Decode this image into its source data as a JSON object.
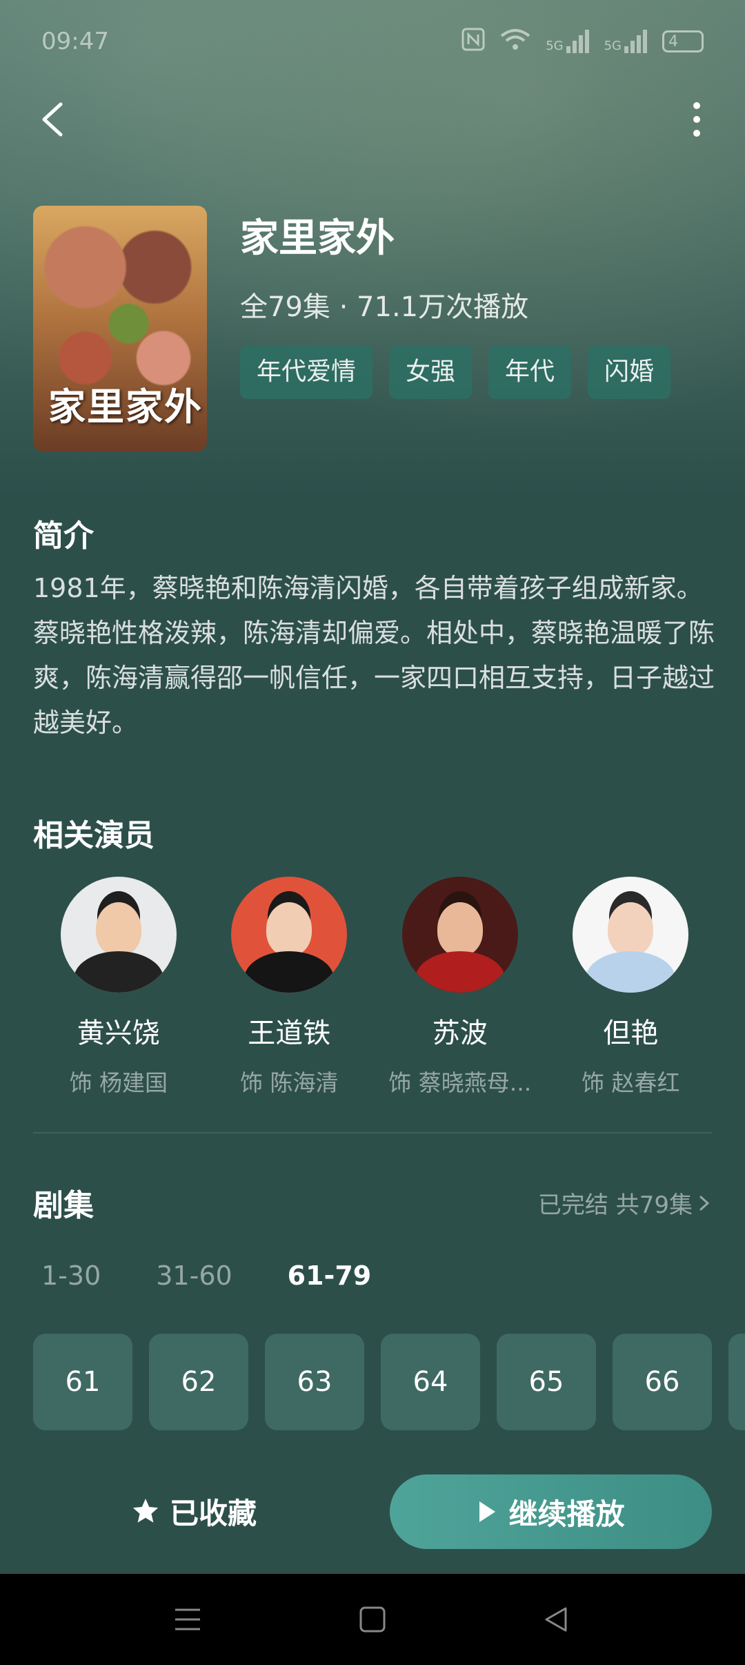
{
  "status_bar": {
    "time": "09:47",
    "network_1": "5G",
    "network_2": "5G",
    "battery": "4"
  },
  "drama": {
    "title": "家里家外",
    "meta": "全79集 · 71.1万次播放",
    "poster_title": "家里家外",
    "tags": [
      "年代爱情",
      "女强",
      "年代",
      "闪婚"
    ]
  },
  "synopsis": {
    "heading": "简介",
    "text": "1981年，蔡晓艳和陈海清闪婚，各自带着孩子组成新家。蔡晓艳性格泼辣，陈海清却偏爱。相处中，蔡晓艳温暖了陈爽，陈海清赢得邵一帆信任，一家四口相互支持，日子越过越美好。"
  },
  "cast": {
    "heading": "相关演员",
    "members": [
      {
        "name": "黄兴饶",
        "role": "饰 杨建国"
      },
      {
        "name": "王道铁",
        "role": "饰 陈海清"
      },
      {
        "name": "苏波",
        "role": "饰 蔡晓燕母..."
      },
      {
        "name": "但艳",
        "role": "饰 赵春红"
      }
    ]
  },
  "episodes": {
    "heading": "剧集",
    "status": "已完结 共79集",
    "ranges": [
      "1-30",
      "31-60",
      "61-79"
    ],
    "active_range": "61-79",
    "items": [
      "61",
      "62",
      "63",
      "64",
      "65",
      "66"
    ]
  },
  "actions": {
    "favorite": "已收藏",
    "play": "继续播放"
  }
}
